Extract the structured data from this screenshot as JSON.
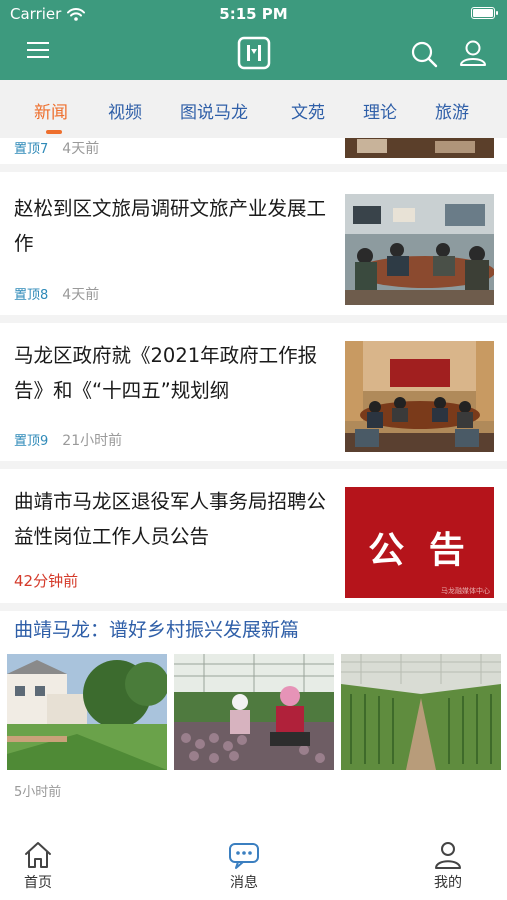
{
  "status_bar": {
    "carrier": "Carrier",
    "time": "5:15 PM"
  },
  "header": {
    "menu_icon": "hamburger-menu-icon",
    "logo_icon": "app-logo-icon",
    "search_icon": "search-icon",
    "user_icon": "user-icon"
  },
  "tabs": [
    {
      "label": "新闻",
      "active": true
    },
    {
      "label": "视频",
      "active": false
    },
    {
      "label": "图说马龙",
      "active": false
    },
    {
      "label": "文苑",
      "active": false
    },
    {
      "label": "理论",
      "active": false
    },
    {
      "label": "旅游",
      "active": false
    }
  ],
  "feed": {
    "items": [
      {
        "pin": "置顶7",
        "time": "4天前"
      },
      {
        "title": "赵松到区文旅局调研文旅产业发展工作",
        "pin": "置顶8",
        "time": "4天前"
      },
      {
        "title": "马龙区政府就《2021年政府工作报告》和《“十四五”规划纲",
        "pin": "置顶9",
        "time": "21小时前"
      },
      {
        "title": "曲靖市马龙区退役军人事务局招聘公益性岗位工作人员公告",
        "time": "42分钟前",
        "image_text": "公 告",
        "image_caption": "马龙融媒体中心"
      },
      {
        "title": "曲靖马龙：谱好乡村振兴发展新篇",
        "time": "5小时前"
      }
    ]
  },
  "bottom_nav": [
    {
      "label": "首页",
      "icon": "home-icon"
    },
    {
      "label": "消息",
      "icon": "chat-bubble-icon"
    },
    {
      "label": "我的",
      "icon": "user-icon"
    }
  ],
  "colors": {
    "brand": "#3d9a7e",
    "tab_text": "#2f5fa8",
    "tab_active": "#ee6f2d",
    "pin": "#2f8ab8",
    "urgent_time": "#d43a2a"
  }
}
